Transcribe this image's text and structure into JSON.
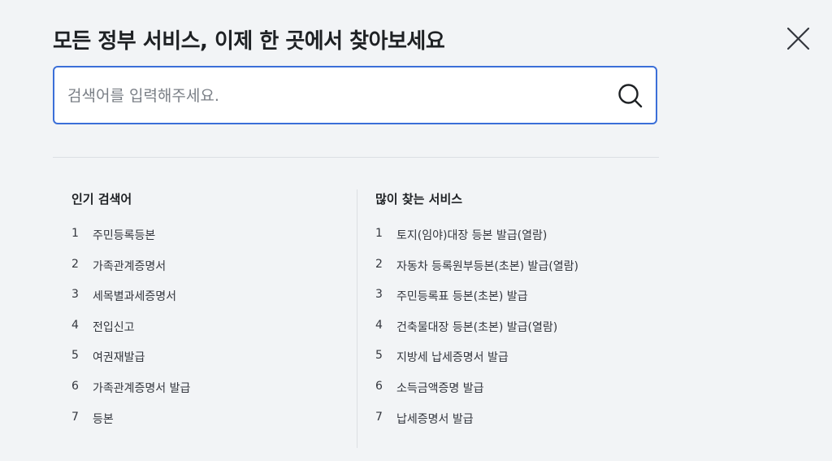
{
  "header": {
    "title": "모든 정부 서비스, 이제 한 곳에서 찾아보세요"
  },
  "search": {
    "placeholder": "검색어를 입력해주세요.",
    "value": ""
  },
  "icons": {
    "close": "close-icon",
    "search": "search-icon"
  },
  "colors": {
    "accent": "#3b6fd8",
    "background": "#f2f4f6"
  },
  "popular": {
    "title": "인기 검색어",
    "items": [
      {
        "rank": "1",
        "label": "주민등록등본"
      },
      {
        "rank": "2",
        "label": "가족관계증명서"
      },
      {
        "rank": "3",
        "label": "세목별과세증명서"
      },
      {
        "rank": "4",
        "label": "전입신고"
      },
      {
        "rank": "5",
        "label": "여권재발급"
      },
      {
        "rank": "6",
        "label": "가족관계증명서 발급"
      },
      {
        "rank": "7",
        "label": "등본"
      }
    ]
  },
  "services": {
    "title": "많이 찾는 서비스",
    "items": [
      {
        "rank": "1",
        "label": "토지(임야)대장 등본 발급(열람)"
      },
      {
        "rank": "2",
        "label": "자동차 등록원부등본(초본) 발급(열람)"
      },
      {
        "rank": "3",
        "label": "주민등록표 등본(초본) 발급"
      },
      {
        "rank": "4",
        "label": "건축물대장 등본(초본) 발급(열람)"
      },
      {
        "rank": "5",
        "label": "지방세 납세증명서 발급"
      },
      {
        "rank": "6",
        "label": "소득금액증명 발급"
      },
      {
        "rank": "7",
        "label": "납세증명서 발급"
      }
    ]
  }
}
